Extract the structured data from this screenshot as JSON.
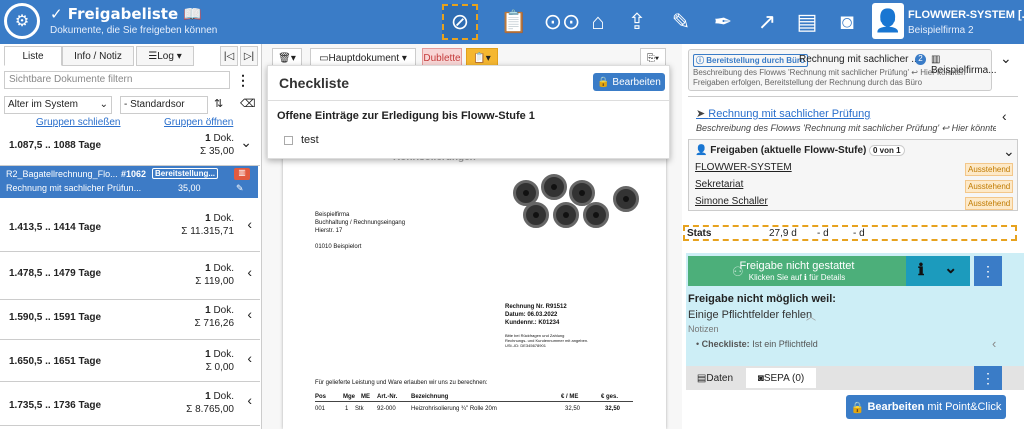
{
  "header": {
    "title": "Freigabeliste",
    "subtitle": "Dokumente, die Sie freigeben können",
    "user_name": "FLOWWER-SYSTEM [...",
    "user_company": "Beispielfirma 2",
    "toolbar_icons": [
      "no-access-icon",
      "clipboard-icon",
      "binoculars-icon",
      "home-icon",
      "upload-icon",
      "edit-icon",
      "pen-icon",
      "trend-up-icon",
      "chart-icon",
      "camera-icon"
    ]
  },
  "left": {
    "tabs": {
      "list": "Liste",
      "info": "Info / Notiz",
      "log": "Log ▾"
    },
    "filter_placeholder": "Sichtbare Dokumente filtern",
    "sort1": "Alter im System",
    "sort2": "- Standardsor",
    "link_close": "Gruppen schließen",
    "link_open": "Gruppen öffnen",
    "groups": [
      {
        "range": "1.087,5 .. 1088 Tage",
        "count": "1",
        "count_label": "Dok.",
        "sum": "Σ 35,00",
        "chev": "⌄"
      },
      {
        "range": "1.413,5 .. 1414 Tage",
        "count": "1",
        "count_label": "Dok.",
        "sum": "Σ 11.315,71",
        "chev": "‹"
      },
      {
        "range": "1.478,5 .. 1479 Tage",
        "count": "1",
        "count_label": "Dok.",
        "sum": "Σ 119,00",
        "chev": "‹"
      },
      {
        "range": "1.590,5 .. 1591 Tage",
        "count": "1",
        "count_label": "Dok.",
        "sum": "Σ 716,26",
        "chev": "‹"
      },
      {
        "range": "1.650,5 .. 1651 Tage",
        "count": "1",
        "count_label": "Dok.",
        "sum": "Σ 0,00",
        "chev": "‹"
      },
      {
        "range": "1.735,5 .. 1736 Tage",
        "count": "1",
        "count_label": "Dok.",
        "sum": "Σ 8.765,00",
        "chev": "‹"
      }
    ],
    "doc": {
      "name": "R2_Bagatellrechnung_Flo...",
      "num": "#1062",
      "status": "Bereitstellung...",
      "flow": "Rechnung mit sachlicher Prüfun...",
      "amount": "35,00"
    }
  },
  "mid": {
    "main_doc": "Hauptdokument",
    "dublette": "Dublette",
    "checklist_title": "Checkliste",
    "edit_btn": "Bearbeiten",
    "checklist_subtitle": "Offene Einträge zur Erledigung bis Floww-Stufe 1",
    "checklist_item": "test",
    "paper": {
      "heading": "Rohrisolierungen",
      "addr": [
        "Beispielfirma",
        "Buchhaltung / Rechnungseingang",
        "Hierstr. 17",
        "",
        "01010 Beispielort"
      ],
      "inv_no": "Rechnung Nr. R91512",
      "inv_date": "Datum: 06.03.2022",
      "cust": "Kundennr.: K01234",
      "hint": [
        "Bitte bei Rückfragen und Zahlung",
        "Rechnungs- und Kundennummer mit angeben.",
        "USt.-ID: DE345678901"
      ],
      "intro": "Für gelieferte Leistung und Ware erlauben wir uns zu berechnen:",
      "cols": [
        "Pos",
        "Mge",
        "ME",
        "Art.-Nr.",
        "Bezeichnung",
        "€ / ME",
        "€ ges."
      ],
      "row": [
        "001",
        "1",
        "Stk",
        "92-000",
        "Heizrohrisolierung ¾\" Rolle 20m",
        "32,50",
        "32,50"
      ]
    }
  },
  "right": {
    "status_badge": "Bereitstellung durch Büro",
    "flow_name": "Rechnung mit sachlicher ...",
    "step_count": "2",
    "company": "Beispielfirma...",
    "flow_desc": "Beschreibung des Flowws 'Rechnung mit sachlicher Prüfung' ↩ Hier könnten Freigaben erfolgen, Bereitstellung der Rechnung durch das Büro",
    "flow_link": "Rechnung mit sachlicher Prüfung",
    "flow_link_desc": "Beschreibung des Flowws 'Rechnung mit sachlicher Prüfung' ↩ Hier könnten ...",
    "approvals_title": "Freigaben (aktuelle Floww-Stufe)",
    "approvals_count": "0 von 1",
    "approvers": [
      {
        "name": "FLOWWER-SYSTEM",
        "state": "Ausstehend"
      },
      {
        "name": "Sekretariat",
        "state": "Ausstehend"
      },
      {
        "name": "Simone Schaller",
        "state": "Ausstehend"
      }
    ],
    "stats_label": "Stats",
    "stats_values": [
      "27,9 d",
      "- d",
      "- d"
    ],
    "release_btn": "Freigabe nicht gestattet",
    "release_sub": "Klicken Sie auf ℹ für Details",
    "info_title": "Freigabe nicht möglich weil:",
    "info_reason": "Einige Pflichtfelder fehlen",
    "notes_label": "Notizen",
    "note_item_bold": "Checkliste:",
    "note_item_rest": " Ist ein Pflichtfeld",
    "tab_daten": "Daten",
    "tab_sepa": "SEPA (0)",
    "edit_btn": "Bearbeiten",
    "edit_btn_sub": "mit Point&Click"
  },
  "colors": {
    "brand": "#3a7cc7",
    "selected": "#3d7bc6",
    "release": "#4caf7a",
    "info_bg": "#cdeef6",
    "pending": "#c07a00"
  }
}
